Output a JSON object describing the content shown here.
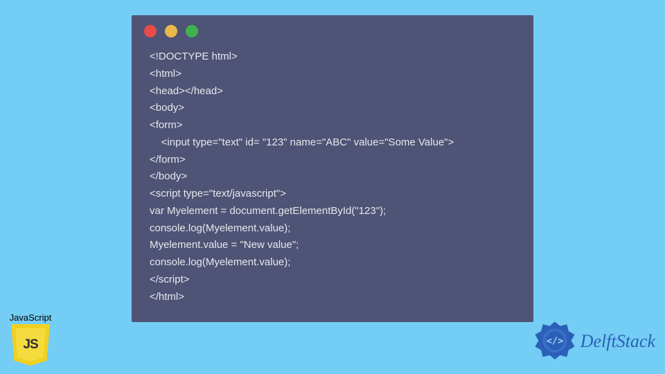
{
  "code_lines": [
    "<!DOCTYPE html>",
    "<html>",
    "<head></head>",
    "<body>",
    "<form>",
    "    <input type=\"text\" id= \"123\" name=\"ABC\" value=\"Some Value\">",
    "</form>",
    "</body>",
    "<script type=\"text/javascript\">",
    "var Myelement = document.getElementById(\"123\");",
    "console.log(Myelement.value);",
    "Myelement.value = \"New value\";",
    "console.log(Myelement.value);",
    "</script>",
    "</html>"
  ],
  "js_badge": {
    "label": "JavaScript",
    "shield_text": "JS"
  },
  "brand": {
    "name": "DelftStack"
  },
  "traffic_lights": {
    "red": "#e94b4b",
    "yellow": "#e9b84b",
    "green": "#3fb24f"
  }
}
